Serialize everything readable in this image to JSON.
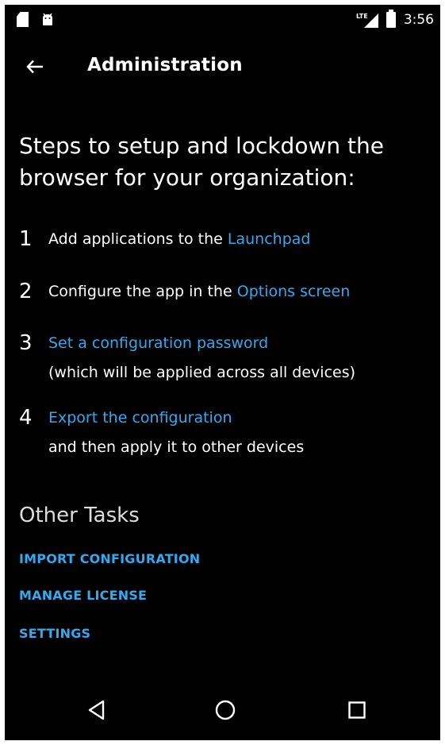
{
  "status_bar": {
    "network": "LTE",
    "time": "3:56",
    "icons": [
      "sd-card-icon",
      "android-icon",
      "lte-signal-icon",
      "battery-icon"
    ]
  },
  "toolbar": {
    "title": "Administration",
    "back_icon": "arrow-left-icon"
  },
  "heading": "Steps to setup and lockdown the browser for your organization:",
  "steps": [
    {
      "number": "1",
      "text": "Add applications to the ",
      "link": "Launchpad"
    },
    {
      "number": "2",
      "text": "Configure the app in the ",
      "link": "Options screen"
    },
    {
      "number": "3",
      "link": "Set a configuration password",
      "detail": "(which will be applied across all devices)"
    },
    {
      "number": "4",
      "link": "Export the configuration",
      "detail": "and then apply it to other devices"
    }
  ],
  "other_tasks": {
    "heading": "Other Tasks",
    "items": [
      "IMPORT CONFIGURATION",
      "MANAGE LICENSE",
      "SETTINGS"
    ]
  },
  "nav_bar": {
    "icons": [
      "nav-back-icon",
      "nav-home-icon",
      "nav-recents-icon"
    ]
  },
  "colors": {
    "background": "#000000",
    "text": "#ffffff",
    "link": "#33aaf0",
    "subheading": "#dddddd",
    "page_frame": "#ffffff"
  }
}
